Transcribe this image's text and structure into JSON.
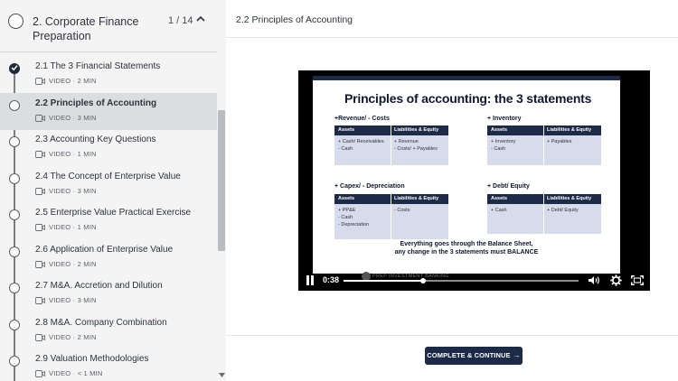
{
  "section": {
    "title": "2. Corporate Finance Preparation",
    "count": "1 / 14"
  },
  "lessons": [
    {
      "title": "2.1 The 3 Financial Statements",
      "meta": "VIDEO · 2 MIN"
    },
    {
      "title": "2.2 Principles of Accounting",
      "meta": "VIDEO · 3 MIN"
    },
    {
      "title": "2.3 Accounting Key Questions",
      "meta": "VIDEO · 1 MIN"
    },
    {
      "title": "2.4 The Concept of Enterprise Value",
      "meta": "VIDEO · 3 MIN"
    },
    {
      "title": "2.5 Enterprise Value Practical Exercise",
      "meta": "VIDEO · 1 MIN"
    },
    {
      "title": "2.6 Application of Enterprise Value",
      "meta": "VIDEO · 2 MIN"
    },
    {
      "title": "2.7 M&A. Accretion and Dilution",
      "meta": "VIDEO · 3 MIN"
    },
    {
      "title": "2.8 M&A. Company Combination",
      "meta": "VIDEO · 2 MIN"
    },
    {
      "title": "2.9 Valuation Methodologies",
      "meta": "VIDEO · < 1 MIN"
    }
  ],
  "main": {
    "title": "2.2 Principles of Accounting"
  },
  "slide": {
    "title": "Principles of accounting: the 3 statements",
    "blocks": [
      {
        "label": "+Revenue/ - Costs",
        "head_a": "Assets",
        "head_b": "Liabilities & Equity",
        "col_a": [
          "+ Cash/ Receivables",
          "- Cash"
        ],
        "col_b": [
          "+ Revenue",
          "- Costs/ + Payables"
        ]
      },
      {
        "label": "+ Inventory",
        "head_a": "Assets",
        "head_b": "Liabilities & Equity",
        "col_a": [
          "+ Inventory",
          "- Cash"
        ],
        "col_b": [
          "+ Payables"
        ]
      },
      {
        "label": "+ Capex/ - Depreciation",
        "head_a": "Assets",
        "head_b": "Liabilities & Equity",
        "col_a": [
          "+ PP&E",
          "- Cash",
          "- Depreciation"
        ],
        "col_b": [
          "- Costs"
        ]
      },
      {
        "label": "+ Debt/ Equity",
        "head_a": "Assets",
        "head_b": "Liabilities & Equity",
        "col_a": [
          "+ Cash"
        ],
        "col_b": [
          "+ Debt/ Equity"
        ]
      }
    ],
    "note_line1": "Everything goes through the Balance Sheet,",
    "note_line2": "any change in the 3 statements must BALANCE",
    "watermark": "PREP INVESTMENT BANKING"
  },
  "player": {
    "time": "0:38",
    "progress_fraction": 0.34
  },
  "footer": {
    "complete_label": "COMPLETE & CONTINUE",
    "complete_arrow": "→"
  },
  "colors": {
    "accent": "#1b2a47",
    "active_row": "#dcdde0",
    "table_body": "#d6dceb"
  }
}
